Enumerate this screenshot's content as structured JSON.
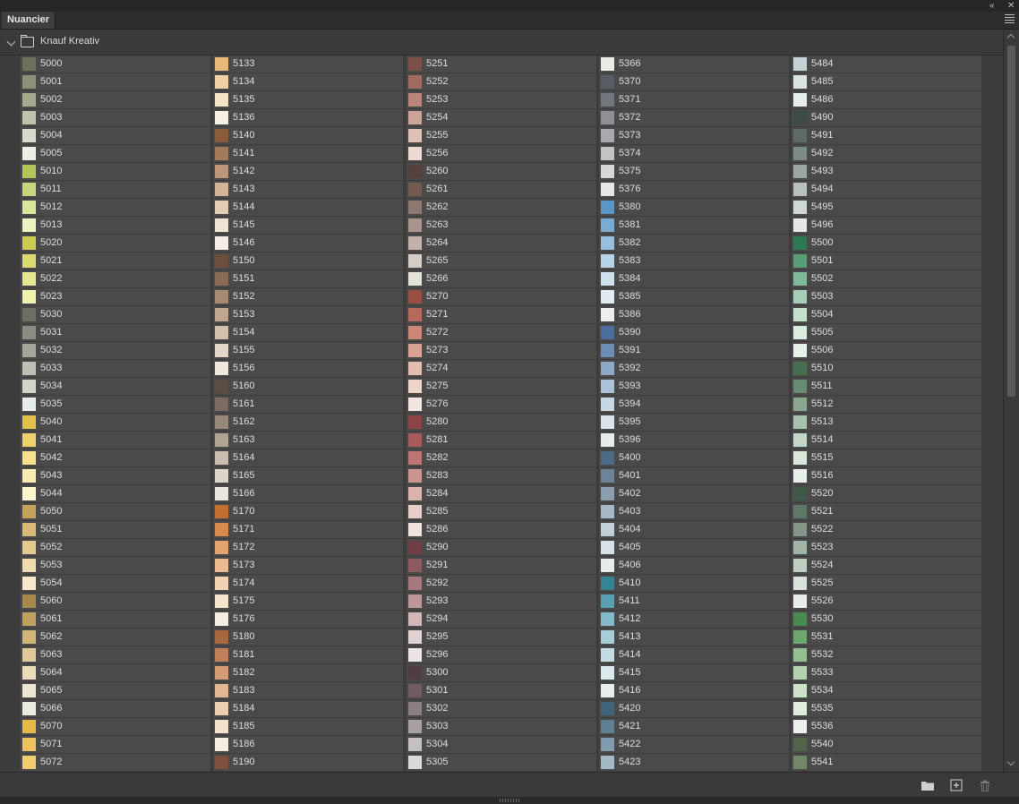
{
  "panel": {
    "tab_label": "Nuancier",
    "group_name": "Knauf Kreativ"
  },
  "icons": {
    "collapse": "double-chevron-left-icon",
    "close": "close-icon",
    "menu": "panel-menu-icon",
    "new_group": "folder-icon",
    "new_swatch": "new-swatch-icon",
    "delete": "trash-icon"
  },
  "columns": [
    [
      {
        "code": "5000",
        "color": "#6c705a"
      },
      {
        "code": "5001",
        "color": "#8c9175"
      },
      {
        "code": "5002",
        "color": "#a6a98c"
      },
      {
        "code": "5003",
        "color": "#bfc1aa"
      },
      {
        "code": "5004",
        "color": "#d8dacb"
      },
      {
        "code": "5005",
        "color": "#ebefe4"
      },
      {
        "code": "5010",
        "color": "#b5c55a"
      },
      {
        "code": "5011",
        "color": "#c8d77d"
      },
      {
        "code": "5012",
        "color": "#dbe69d"
      },
      {
        "code": "5013",
        "color": "#ebf3c0"
      },
      {
        "code": "5020",
        "color": "#cbcb52"
      },
      {
        "code": "5021",
        "color": "#dbdb73"
      },
      {
        "code": "5022",
        "color": "#e6e690"
      },
      {
        "code": "5023",
        "color": "#f0f2ae"
      },
      {
        "code": "5030",
        "color": "#6a7062"
      },
      {
        "code": "5031",
        "color": "#8a8d82"
      },
      {
        "code": "5032",
        "color": "#a3a69b"
      },
      {
        "code": "5033",
        "color": "#bcbfb4"
      },
      {
        "code": "5034",
        "color": "#d3d4c9"
      },
      {
        "code": "5035",
        "color": "#e7ecee"
      },
      {
        "code": "5040",
        "color": "#e0c14c"
      },
      {
        "code": "5041",
        "color": "#eed16a"
      },
      {
        "code": "5042",
        "color": "#f6e08e"
      },
      {
        "code": "5043",
        "color": "#faecb0"
      },
      {
        "code": "5044",
        "color": "#fdf5cc"
      },
      {
        "code": "5050",
        "color": "#c6a35a"
      },
      {
        "code": "5051",
        "color": "#d9b975"
      },
      {
        "code": "5052",
        "color": "#e5ca90"
      },
      {
        "code": "5053",
        "color": "#efdbad"
      },
      {
        "code": "5054",
        "color": "#f6eacb"
      },
      {
        "code": "5060",
        "color": "#a7894a"
      },
      {
        "code": "5061",
        "color": "#c0a160"
      },
      {
        "code": "5062",
        "color": "#d2b57b"
      },
      {
        "code": "5063",
        "color": "#e1c999"
      },
      {
        "code": "5064",
        "color": "#ebdbb8"
      },
      {
        "code": "5065",
        "color": "#efe6d2"
      },
      {
        "code": "5066",
        "color": "#ecebe2"
      },
      {
        "code": "5070",
        "color": "#e7b84a"
      },
      {
        "code": "5071",
        "color": "#ecc35f"
      },
      {
        "code": "5072",
        "color": "#f0cd70"
      }
    ],
    [
      {
        "code": "5133",
        "color": "#e8b878"
      },
      {
        "code": "5134",
        "color": "#f0d0a4"
      },
      {
        "code": "5135",
        "color": "#f5e3c6"
      },
      {
        "code": "5136",
        "color": "#f6efe3"
      },
      {
        "code": "5140",
        "color": "#8a5c3a"
      },
      {
        "code": "5141",
        "color": "#a47a58"
      },
      {
        "code": "5142",
        "color": "#bd9777"
      },
      {
        "code": "5143",
        "color": "#d3b497"
      },
      {
        "code": "5144",
        "color": "#e4cdb6"
      },
      {
        "code": "5145",
        "color": "#efe3d4"
      },
      {
        "code": "5146",
        "color": "#f4eee6"
      },
      {
        "code": "5150",
        "color": "#6b4f3c"
      },
      {
        "code": "5151",
        "color": "#8a6b55"
      },
      {
        "code": "5152",
        "color": "#a68a72"
      },
      {
        "code": "5153",
        "color": "#bfa690"
      },
      {
        "code": "5154",
        "color": "#d3c0ad"
      },
      {
        "code": "5155",
        "color": "#e3d7ca"
      },
      {
        "code": "5156",
        "color": "#eee8df"
      },
      {
        "code": "5160",
        "color": "#5c4e45"
      },
      {
        "code": "5161",
        "color": "#7c6b60"
      },
      {
        "code": "5162",
        "color": "#988879"
      },
      {
        "code": "5163",
        "color": "#b2a493"
      },
      {
        "code": "5164",
        "color": "#c9beaf"
      },
      {
        "code": "5165",
        "color": "#dcd5ca"
      },
      {
        "code": "5166",
        "color": "#ebe7df"
      },
      {
        "code": "5170",
        "color": "#c46e30"
      },
      {
        "code": "5171",
        "color": "#d88a4c"
      },
      {
        "code": "5172",
        "color": "#e4a470"
      },
      {
        "code": "5173",
        "color": "#ecbc90"
      },
      {
        "code": "5174",
        "color": "#f2d1b0"
      },
      {
        "code": "5175",
        "color": "#f6e2cd"
      },
      {
        "code": "5176",
        "color": "#f4ede2"
      },
      {
        "code": "5180",
        "color": "#a8683e"
      },
      {
        "code": "5181",
        "color": "#c0815a"
      },
      {
        "code": "5182",
        "color": "#d59c74"
      },
      {
        "code": "5183",
        "color": "#e3b792"
      },
      {
        "code": "5184",
        "color": "#ecceb0"
      },
      {
        "code": "5185",
        "color": "#f3e1cc"
      },
      {
        "code": "5186",
        "color": "#f5ece2"
      },
      {
        "code": "5190",
        "color": "#7e4f3c"
      }
    ],
    [
      {
        "code": "5251",
        "color": "#7c5046"
      },
      {
        "code": "5252",
        "color": "#a06a5e"
      },
      {
        "code": "5253",
        "color": "#b98579"
      },
      {
        "code": "5254",
        "color": "#cea397"
      },
      {
        "code": "5255",
        "color": "#dfc1b6"
      },
      {
        "code": "5256",
        "color": "#ecd9d1"
      },
      {
        "code": "5260",
        "color": "#553f3b"
      },
      {
        "code": "5261",
        "color": "#735a53"
      },
      {
        "code": "5262",
        "color": "#8e776f"
      },
      {
        "code": "5263",
        "color": "#a8948c"
      },
      {
        "code": "5264",
        "color": "#c2b2aa"
      },
      {
        "code": "5265",
        "color": "#d7cbc5"
      },
      {
        "code": "5266",
        "color": "#e6e0db"
      },
      {
        "code": "5270",
        "color": "#9a4f43"
      },
      {
        "code": "5271",
        "color": "#b56a5c"
      },
      {
        "code": "5272",
        "color": "#c98776"
      },
      {
        "code": "5273",
        "color": "#d8a392"
      },
      {
        "code": "5274",
        "color": "#e4bdae"
      },
      {
        "code": "5275",
        "color": "#eed5ca"
      },
      {
        "code": "5276",
        "color": "#f3e5df"
      },
      {
        "code": "5280",
        "color": "#8e4444"
      },
      {
        "code": "5281",
        "color": "#a65a5a"
      },
      {
        "code": "5282",
        "color": "#bb7672"
      },
      {
        "code": "5283",
        "color": "#cd9590"
      },
      {
        "code": "5284",
        "color": "#dcb2ad"
      },
      {
        "code": "5285",
        "color": "#e8cdc9"
      },
      {
        "code": "5286",
        "color": "#f0e1dd"
      },
      {
        "code": "5290",
        "color": "#6e3e44"
      },
      {
        "code": "5291",
        "color": "#8c5a60"
      },
      {
        "code": "5292",
        "color": "#a7787c"
      },
      {
        "code": "5293",
        "color": "#bd979a"
      },
      {
        "code": "5294",
        "color": "#d3b6b8"
      },
      {
        "code": "5295",
        "color": "#e3d2d2"
      },
      {
        "code": "5296",
        "color": "#ede4e3"
      },
      {
        "code": "5300",
        "color": "#4f3d42"
      },
      {
        "code": "5301",
        "color": "#6f5d62"
      },
      {
        "code": "5302",
        "color": "#8d7e81"
      },
      {
        "code": "5303",
        "color": "#a9a0a2"
      },
      {
        "code": "5304",
        "color": "#c5bfc0"
      },
      {
        "code": "5305",
        "color": "#dcd9d9"
      }
    ],
    [
      {
        "code": "5366",
        "color": "#eaeae6"
      },
      {
        "code": "5370",
        "color": "#5a5c63"
      },
      {
        "code": "5371",
        "color": "#74767d"
      },
      {
        "code": "5372",
        "color": "#8f9096"
      },
      {
        "code": "5373",
        "color": "#a9aaae"
      },
      {
        "code": "5374",
        "color": "#c2c3c5"
      },
      {
        "code": "5375",
        "color": "#d8d8d8"
      },
      {
        "code": "5376",
        "color": "#e7e7e5"
      },
      {
        "code": "5380",
        "color": "#5b97c6"
      },
      {
        "code": "5381",
        "color": "#7aacd3"
      },
      {
        "code": "5382",
        "color": "#98c0de"
      },
      {
        "code": "5383",
        "color": "#b6d3e7"
      },
      {
        "code": "5384",
        "color": "#cfe1ed"
      },
      {
        "code": "5385",
        "color": "#e1ecf0"
      },
      {
        "code": "5386",
        "color": "#ecefee"
      },
      {
        "code": "5390",
        "color": "#4b6e9e"
      },
      {
        "code": "5391",
        "color": "#6c8db5"
      },
      {
        "code": "5392",
        "color": "#8ea9c8"
      },
      {
        "code": "5393",
        "color": "#acc2d8"
      },
      {
        "code": "5394",
        "color": "#c6d6e3"
      },
      {
        "code": "5395",
        "color": "#dbe4ea"
      },
      {
        "code": "5396",
        "color": "#e9eced"
      },
      {
        "code": "5400",
        "color": "#4e6a84"
      },
      {
        "code": "5401",
        "color": "#6d8398"
      },
      {
        "code": "5402",
        "color": "#8a9eb0"
      },
      {
        "code": "5403",
        "color": "#a7b8c6"
      },
      {
        "code": "5404",
        "color": "#c1cfd9"
      },
      {
        "code": "5405",
        "color": "#d7e1e6"
      },
      {
        "code": "5406",
        "color": "#e7ecec"
      },
      {
        "code": "5410",
        "color": "#358496"
      },
      {
        "code": "5411",
        "color": "#5ba0b2"
      },
      {
        "code": "5412",
        "color": "#83b9c8"
      },
      {
        "code": "5413",
        "color": "#a6cdd8"
      },
      {
        "code": "5414",
        "color": "#c4dde4"
      },
      {
        "code": "5415",
        "color": "#dae9ec"
      },
      {
        "code": "5416",
        "color": "#e8eeee"
      },
      {
        "code": "5420",
        "color": "#3f6478"
      },
      {
        "code": "5421",
        "color": "#5f8092"
      },
      {
        "code": "5422",
        "color": "#819dad"
      },
      {
        "code": "5423",
        "color": "#a3bac6"
      }
    ],
    [
      {
        "code": "5484",
        "color": "#c4d3d3"
      },
      {
        "code": "5485",
        "color": "#d9e3e1"
      },
      {
        "code": "5486",
        "color": "#e8eeeb"
      },
      {
        "code": "5490",
        "color": "#3e4a44"
      },
      {
        "code": "5491",
        "color": "#5d6b64"
      },
      {
        "code": "5492",
        "color": "#7e8b85"
      },
      {
        "code": "5493",
        "color": "#9ca7a2"
      },
      {
        "code": "5494",
        "color": "#b8c0bc"
      },
      {
        "code": "5495",
        "color": "#d1d7d3"
      },
      {
        "code": "5496",
        "color": "#e5e8e5"
      },
      {
        "code": "5500",
        "color": "#2d7a52"
      },
      {
        "code": "5501",
        "color": "#589d78"
      },
      {
        "code": "5502",
        "color": "#80b999"
      },
      {
        "code": "5503",
        "color": "#a5cfb7"
      },
      {
        "code": "5504",
        "color": "#c4e0cf"
      },
      {
        "code": "5505",
        "color": "#dbecdf"
      },
      {
        "code": "5506",
        "color": "#e8f0ea"
      },
      {
        "code": "5510",
        "color": "#466e50"
      },
      {
        "code": "5511",
        "color": "#668b70"
      },
      {
        "code": "5512",
        "color": "#87a791"
      },
      {
        "code": "5513",
        "color": "#a7c1ae"
      },
      {
        "code": "5514",
        "color": "#c3d6c8"
      },
      {
        "code": "5515",
        "color": "#dae6dc"
      },
      {
        "code": "5516",
        "color": "#e8eee8"
      },
      {
        "code": "5520",
        "color": "#40584a"
      },
      {
        "code": "5521",
        "color": "#607768"
      },
      {
        "code": "5522",
        "color": "#829689"
      },
      {
        "code": "5523",
        "color": "#a2b3a7"
      },
      {
        "code": "5524",
        "color": "#bfcdc3"
      },
      {
        "code": "5525",
        "color": "#d7e0d9"
      },
      {
        "code": "5526",
        "color": "#e7ece8"
      },
      {
        "code": "5530",
        "color": "#4a8a4e"
      },
      {
        "code": "5531",
        "color": "#6ea66f"
      },
      {
        "code": "5532",
        "color": "#92bf90"
      },
      {
        "code": "5533",
        "color": "#b2d3ae"
      },
      {
        "code": "5534",
        "color": "#cde2c8"
      },
      {
        "code": "5535",
        "color": "#e0ede0"
      },
      {
        "code": "5536",
        "color": "#ebf0ea"
      },
      {
        "code": "5540",
        "color": "#4f6448"
      },
      {
        "code": "5541",
        "color": "#738766"
      }
    ]
  ]
}
